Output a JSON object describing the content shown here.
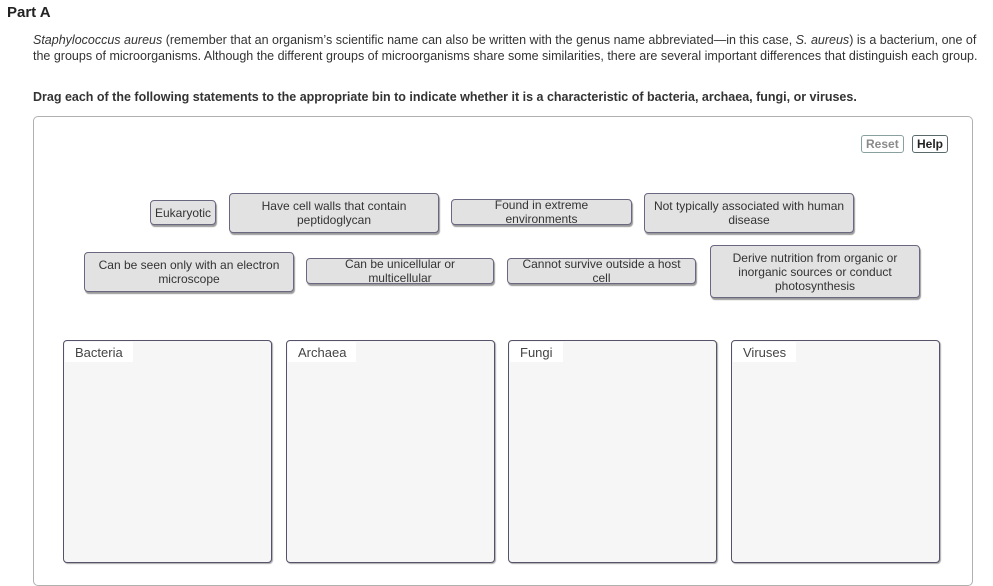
{
  "part": {
    "title": "Part A"
  },
  "intro": {
    "species_italic": "Staphylococcus aureus",
    "text_1": " (remember that an organism’s scientific name can also be written with the genus name abbreviated—in this case, ",
    "abbrev_italic": "S. aureus",
    "text_2": ") is a bacterium, one of the groups of microorganisms. Although the different groups of microorganisms share some similarities, there are several important differences that distinguish each group."
  },
  "instruction": "Drag each of the following statements to the appropriate bin to indicate whether it is a characteristic of bacteria, archaea, fungi, or viruses.",
  "toolbar": {
    "reset_label": "Reset",
    "help_label": "Help"
  },
  "statements": [
    "Eukaryotic",
    "Have cell walls that contain peptidoglycan",
    "Found in extreme environments",
    "Not typically associated with human disease",
    "Can be seen only with an electron microscope",
    "Can be unicellular or multicellular",
    "Cannot survive outside a host cell",
    "Derive nutrition from organic or inorganic sources or conduct photosynthesis"
  ],
  "bins": [
    {
      "label": "Bacteria"
    },
    {
      "label": "Archaea"
    },
    {
      "label": "Fungi"
    },
    {
      "label": "Viruses"
    }
  ]
}
